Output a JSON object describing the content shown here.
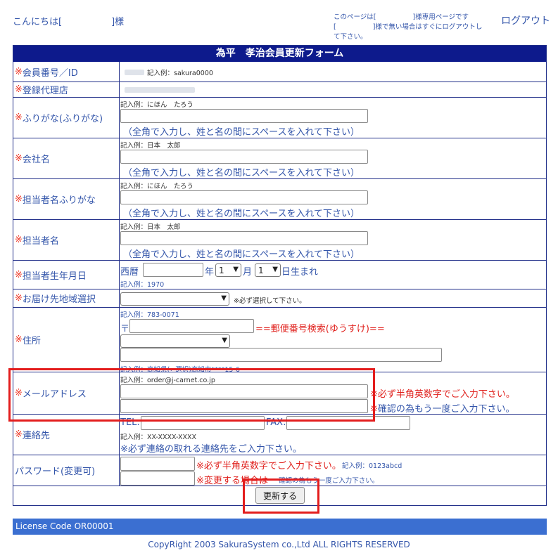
{
  "header": {
    "greeting_prefix": "こんにちは[",
    "greeting_suffix": "]様",
    "notice_line1_prefix": "このページは[",
    "notice_line1_suffix": "]様専用ページです",
    "notice_line2_prefix": "[",
    "notice_line2_suffix": "]様で無い場合はすぐにログアウトし",
    "notice_line3": "て下さい。",
    "logout_label": "ログアウト"
  },
  "form": {
    "title": "為平　孝治会員更新フォーム",
    "required_mark": "※",
    "rows": {
      "member_id": {
        "label": "会員番号／ID",
        "example": "記入例：sakura0000"
      },
      "agency": {
        "label": "登録代理店"
      },
      "furigana": {
        "label": "ふりがな(ふりがな)",
        "example": "記入例：にほん　たろう",
        "hint": "（全角で入力し、姓と名の間にスペースを入れて下さい）"
      },
      "company": {
        "label": "会社名",
        "example": "記入例：日本　太郎",
        "hint": "（全角で入力し、姓と名の間にスペースを入れて下さい）"
      },
      "contact_furigana": {
        "label": "担当者名ふりがな",
        "example": "記入例：にほん　たろう",
        "hint": "（全角で入力し、姓と名の間にスペースを入れて下さい）"
      },
      "contact_name": {
        "label": "担当者名",
        "example": "記入例：日本　太郎",
        "hint": "（全角で入力し、姓と名の間にスペースを入れて下さい）"
      },
      "birthday": {
        "label": "担当者生年月日",
        "era": "西暦",
        "year_unit": "年",
        "month_value": "1",
        "month_unit": "月",
        "day_value": "1",
        "day_unit": "日生まれ",
        "example": "記入例：1970"
      },
      "region": {
        "label": "お届け先地域選択",
        "note": "※必ず選択して下さい。"
      },
      "address": {
        "label": "住所",
        "example_zip": "記入例：783-0071",
        "zip_mark": "〒",
        "zip_search": "==郵便番号検索(ゆうすけ)==",
        "example_address": "記入例：高知県(←選択)高知市****15-6"
      },
      "email": {
        "label": "メールアドレス",
        "example": "記入例：order@j-carnet.co.jp",
        "note1": "※必ず半角英数字でご入力下さい。",
        "note2": "※確認の為もう一度ご入力下さい。"
      },
      "phone": {
        "label": "連絡先",
        "tel_label": "TEL:",
        "fax_label": "FAX:",
        "example": "記入例：XX-XXXX-XXXX",
        "hint": "※必ず連絡の取れる連絡先をご入力下さい。"
      },
      "password": {
        "label": "パスワード(変更可)",
        "note1": "※必ず半角英数字でご入力下さい。",
        "example": "記入例：0123abcd",
        "note2": "※変更する場合は",
        "note2_small": "確認の為もう一度ご入力下さい。"
      }
    },
    "submit_label": "更新する"
  },
  "footer": {
    "license": "License Code OR00001",
    "copyright": "CopyRight 2003 SakuraSystem co.,Ltd ALL RIGHTS RESERVED"
  },
  "colors": {
    "title_bar": "#0d1a8c",
    "license_bar": "#3b6fd1",
    "highlight": "#e31d1d",
    "label_text": "#3355aa"
  }
}
